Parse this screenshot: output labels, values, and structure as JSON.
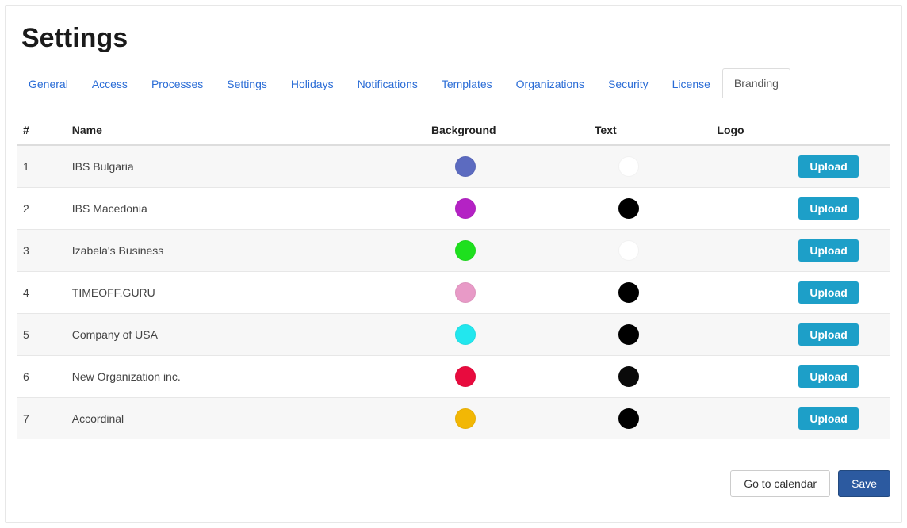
{
  "page_title": "Settings",
  "tabs": [
    {
      "label": "General",
      "active": false
    },
    {
      "label": "Access",
      "active": false
    },
    {
      "label": "Processes",
      "active": false
    },
    {
      "label": "Settings",
      "active": false
    },
    {
      "label": "Holidays",
      "active": false
    },
    {
      "label": "Notifications",
      "active": false
    },
    {
      "label": "Templates",
      "active": false
    },
    {
      "label": "Organizations",
      "active": false
    },
    {
      "label": "Security",
      "active": false
    },
    {
      "label": "License",
      "active": false
    },
    {
      "label": "Branding",
      "active": true
    }
  ],
  "table": {
    "headers": {
      "index": "#",
      "name": "Name",
      "background": "Background",
      "text": "Text",
      "logo": "Logo"
    },
    "upload_label": "Upload",
    "rows": [
      {
        "index": "1",
        "name": "IBS Bulgaria",
        "background_color": "#5c6bc0",
        "text_color": "#ffffff"
      },
      {
        "index": "2",
        "name": "IBS Macedonia",
        "background_color": "#b422c4",
        "text_color": "#000000"
      },
      {
        "index": "3",
        "name": "Izabela's Business",
        "background_color": "#1ee01e",
        "text_color": "#ffffff"
      },
      {
        "index": "4",
        "name": "TIMEOFF.GURU",
        "background_color": "#e89ac7",
        "text_color": "#000000"
      },
      {
        "index": "5",
        "name": "Company of USA",
        "background_color": "#22e7ee",
        "text_color": "#000000"
      },
      {
        "index": "6",
        "name": "New Organization inc.",
        "background_color": "#e80b3e",
        "text_color": "#0a0a0a"
      },
      {
        "index": "7",
        "name": "Accordinal",
        "background_color": "#f2b705",
        "text_color": "#000000"
      }
    ]
  },
  "footer": {
    "go_to_calendar": "Go to calendar",
    "save": "Save"
  }
}
